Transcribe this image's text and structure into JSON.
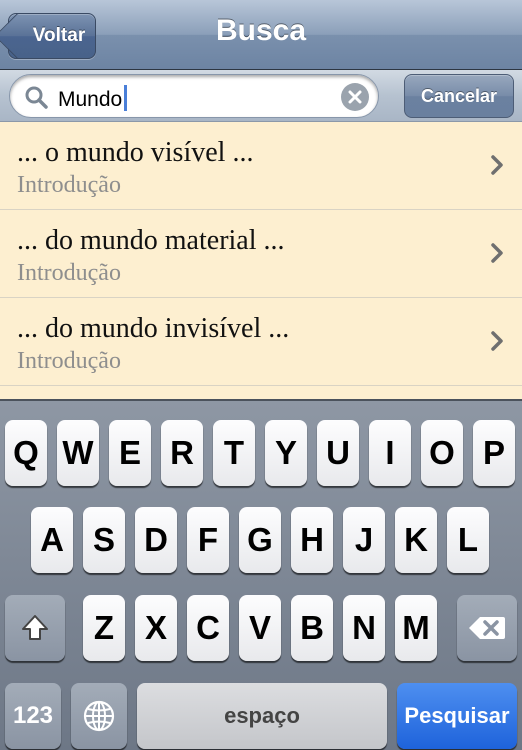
{
  "nav": {
    "back_label": "Voltar",
    "title": "Busca"
  },
  "search": {
    "value": "Mundo",
    "cancel_label": "Cancelar"
  },
  "results": [
    {
      "title": "... o mundo visível ...",
      "subtitle": "Introdução"
    },
    {
      "title": "... do mundo material ...",
      "subtitle": "Introdução"
    },
    {
      "title": "... do mundo invisível ...",
      "subtitle": "Introdução"
    }
  ],
  "keyboard": {
    "row1": [
      "Q",
      "W",
      "E",
      "R",
      "T",
      "Y",
      "U",
      "I",
      "O",
      "P"
    ],
    "row2": [
      "A",
      "S",
      "D",
      "F",
      "G",
      "H",
      "J",
      "K",
      "L"
    ],
    "row3": [
      "Z",
      "X",
      "C",
      "V",
      "B",
      "N",
      "M"
    ],
    "numbers_label": "123",
    "space_label": "espaço",
    "search_label": "Pesquisar"
  },
  "icons": {
    "back": "back-arrow-button",
    "search": "magnifier-icon",
    "clear": "clear-x-icon",
    "chevron": "chevron-right-icon",
    "shift": "shift-arrow-icon",
    "delete": "backspace-icon",
    "globe": "globe-icon"
  },
  "colors": {
    "nav_bar": "#7a90ad",
    "results_bg": "#fdefd0",
    "search_key": "#1e63db",
    "caret": "#4a7fd8"
  }
}
